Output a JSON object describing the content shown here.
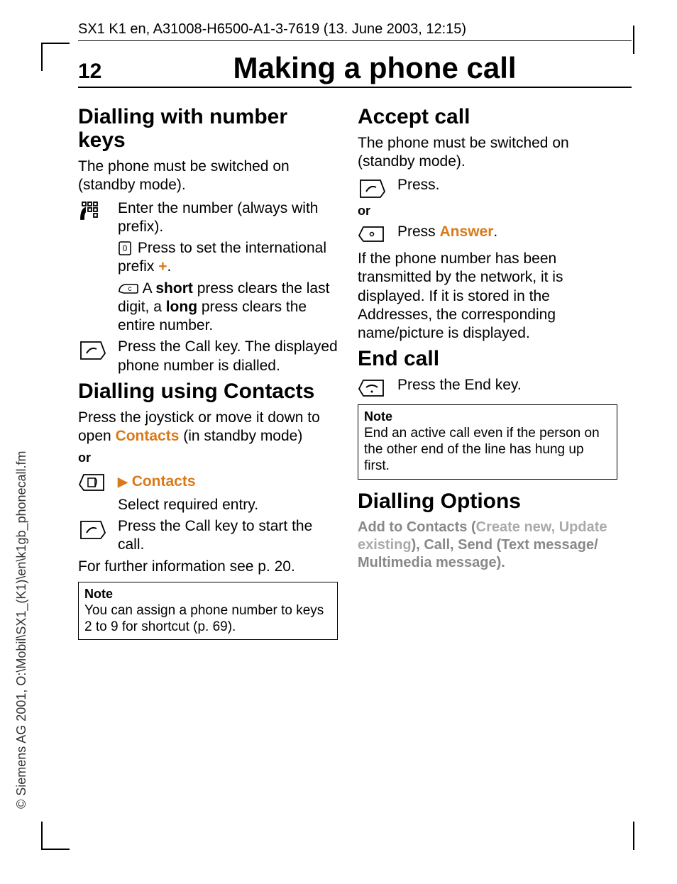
{
  "side_text": "© Siemens AG 2001, O:\\Mobil\\SX1_(K1)\\en\\k1gb_phonecall.fm",
  "header": "SX1 K1 en, A31008-H6500-A1-3-7619 (13. June 2003, 12:15)",
  "page_number": "12",
  "page_title": "Making a phone call",
  "left": {
    "h1": "Dialling with number keys",
    "p1": "The phone must be switched on (standby mode).",
    "r1": "Enter the number (always with prefix).",
    "r2a": "  Press to set the international prefix ",
    "r2b": "+",
    "r2c": ".",
    "r3a": " A ",
    "r3b": "short",
    "r3c": " press clears the last digit, a ",
    "r3d": "long",
    "r3e": " press clears the entire number.",
    "r4": "Press the Call key. The displayed phone number is dialled.",
    "h2": "Dialling using Contacts",
    "p2a": "Press the joystick or move it down to open ",
    "p2b": "Contacts",
    "p2c": " (in standby mode)",
    "or": "or",
    "menu_arrow": "▶",
    "contacts_label": "Contacts",
    "r5": "Select required entry.",
    "r6": "Press the Call key to start the call.",
    "p3": "For further information see p. 20.",
    "note_title": "Note",
    "note_body": "You can assign a phone number to keys 2 to 9 for shortcut (p. 69)."
  },
  "right": {
    "h1": "Accept call",
    "p1": "The phone must be switched on (standby mode).",
    "r1": "Press.",
    "or": "or",
    "r2a": "Press ",
    "r2b": "Answer",
    "r2c": ".",
    "p2": "If the phone number has been transmitted by the network, it is displayed. If it is stored in the Addresses, the corresponding name/picture is displayed.",
    "h2": "End call",
    "r3": "Press the End key.",
    "note_title": "Note",
    "note_body": "End an active call even if the person on the other end of the line has hung up first.",
    "h3": "Dialling Options",
    "opts_a": "Add to Contacts (",
    "opts_b": "Create new, Update existing",
    "opts_c": "), Call, Send (Text message/ Multimedia message)."
  }
}
